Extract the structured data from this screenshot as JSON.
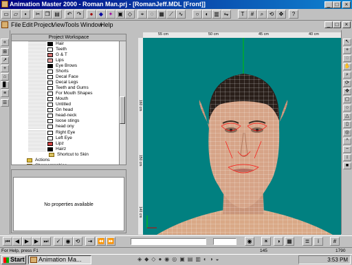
{
  "window": {
    "title": "Animation Master 2000 - Roman Man.prj - [RomanJeff.MDL [Front]]",
    "controls": [
      "_",
      "□",
      "×"
    ],
    "child_controls": [
      "_",
      "□",
      "×"
    ]
  },
  "menu": [
    "File",
    "Edit",
    "Project",
    "View",
    "Tools",
    "Window",
    "Help"
  ],
  "workspace": {
    "title": "Project Workspace",
    "items": [
      {
        "label": "Hair",
        "color": "#000000"
      },
      {
        "label": "Teeth",
        "color": "#ffffff"
      },
      {
        "label": "G & T",
        "color": "#d07070"
      },
      {
        "label": "Lips",
        "color": "#e8a0a0"
      },
      {
        "label": "Eye Brows",
        "color": "#000000"
      },
      {
        "label": "Shorts",
        "color": "#ffffff"
      },
      {
        "label": "Decal Face",
        "color": "#ffffff"
      },
      {
        "label": "Decal Legs",
        "color": "#ffffff"
      },
      {
        "label": "Teeth and Gums",
        "color": "#ffffff"
      },
      {
        "label": "For Mouth Shapes",
        "color": "#ffffff"
      },
      {
        "label": "Mouth",
        "color": "#ffffff"
      },
      {
        "label": "Untitled",
        "color": "#ffffff"
      },
      {
        "label": "Gn head",
        "color": "#ffffff"
      },
      {
        "label": "head-neck",
        "color": "#ffffff"
      },
      {
        "label": "loose stings",
        "color": "#ffffff"
      },
      {
        "label": "head ony",
        "color": "#ffffff"
      },
      {
        "label": "Right Eye",
        "color": "#ffffff"
      },
      {
        "label": "Left Eye",
        "color": "#ffffff"
      },
      {
        "label": "Lipz",
        "color": "#d04040"
      },
      {
        "label": "Hairz",
        "color": "#000000"
      }
    ],
    "shortcut": "Shortcut to Skin",
    "actions": "Actions",
    "choreographies": "Choreographies"
  },
  "properties": {
    "message": "No properties available"
  },
  "ruler": {
    "top": [
      "55 cm",
      "50 cm",
      "45 cm",
      "40 cm"
    ],
    "left": [
      "160 cm",
      "150 cm",
      "140 cm"
    ]
  },
  "status": {
    "help": "For Help, press F1",
    "frame": "145",
    "value": "1790"
  },
  "taskbar": {
    "start": "Start",
    "task": "Animation Ma...",
    "clock": "3:53 PM"
  },
  "colors": {
    "titlebar": "#000080",
    "canvas": "#018080",
    "mesh": "#ffffff",
    "spline_accent": "#ff0000"
  }
}
